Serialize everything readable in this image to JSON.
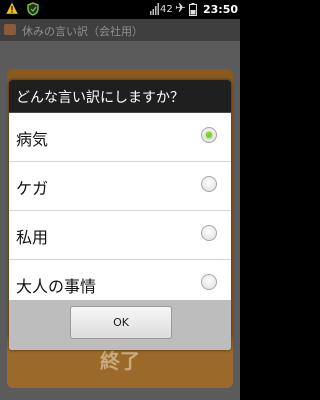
{
  "status_bar": {
    "icons": [
      "warning-icon",
      "shield-icon",
      "signal-icon",
      "airplane-icon",
      "battery-icon"
    ],
    "battery_percent": "42",
    "time": "23:50"
  },
  "app": {
    "title": "休みの言い訳（会社用）",
    "finish_button": "終了"
  },
  "dialog": {
    "title": "どんな言い訳にしますか？",
    "options": [
      {
        "label": "病気",
        "selected": true
      },
      {
        "label": "ケガ",
        "selected": false
      },
      {
        "label": "私用",
        "selected": false
      },
      {
        "label": "大人の事情",
        "selected": false
      }
    ],
    "ok_label": "OK"
  }
}
